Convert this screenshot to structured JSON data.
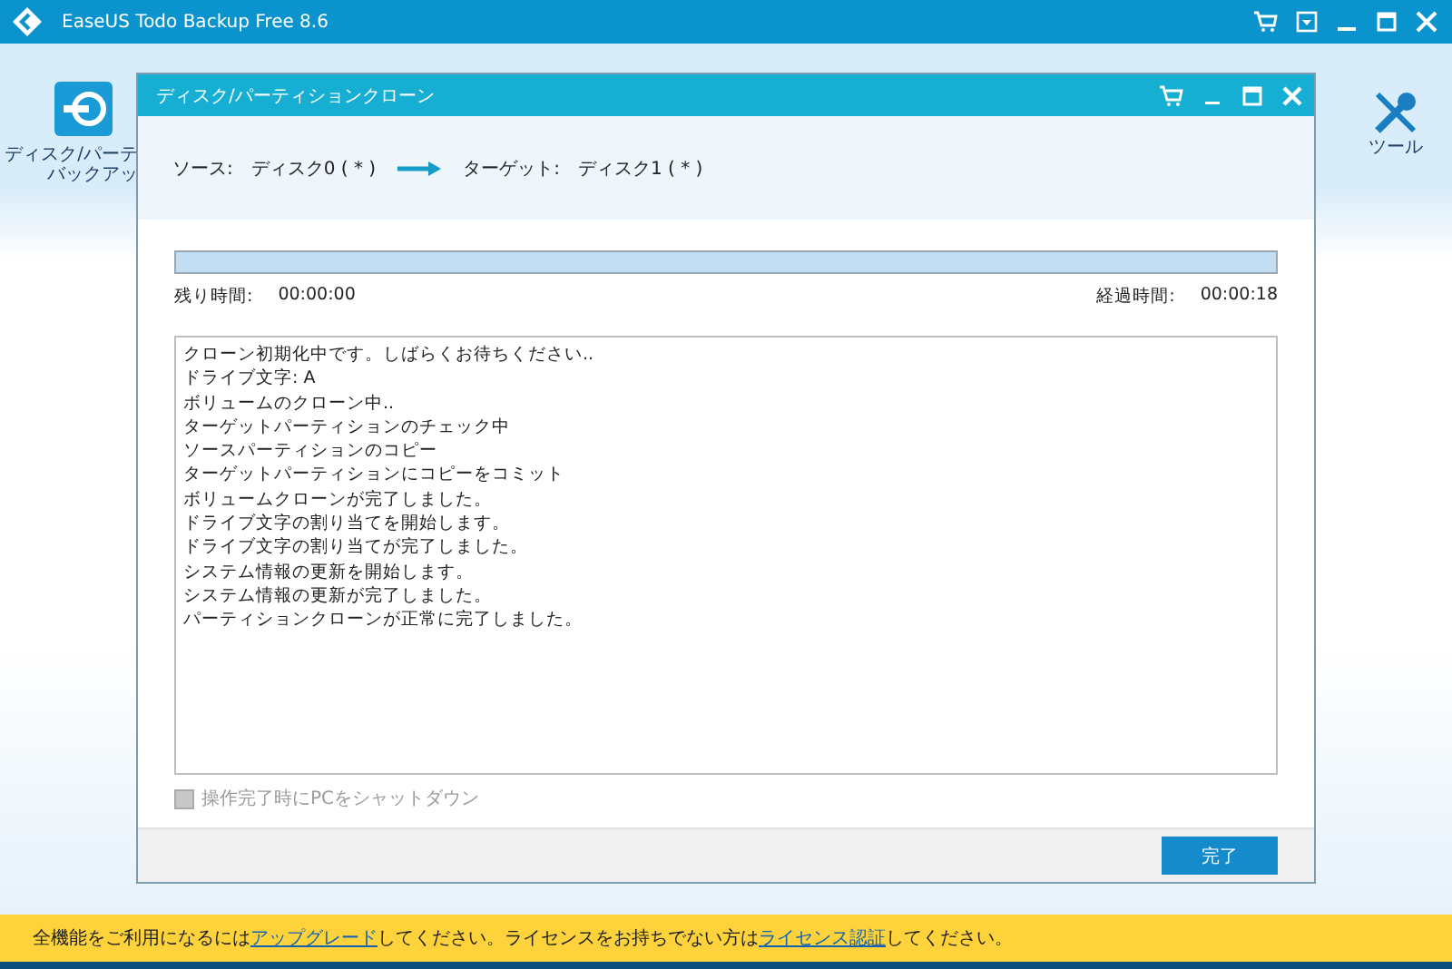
{
  "window": {
    "title": "EaseUS Todo Backup Free 8.6"
  },
  "toolbar": {
    "left_item": {
      "label_lines": [
        "ディスク/パーテ",
        "バックアッ"
      ]
    },
    "right_item": {
      "label": "ツール"
    }
  },
  "dialog": {
    "title": "ディスク/パーティションクローン",
    "source_label": "ソース:",
    "source_value": "ディスク0 ( * )",
    "target_label": "ターゲット:",
    "target_value": "ディスク1 ( * )",
    "progress": {
      "level": 1
    },
    "remaining_label": "残り時間:",
    "remaining_value": "00:00:00",
    "elapsed_label": "経過時間:",
    "elapsed_value": "00:00:18",
    "log": [
      "クローン初期化中です。しばらくお待ちください..",
      "ドライブ文字: A",
      "ボリュームのクローン中..",
      "ターゲットパーティションのチェック中",
      "ソースパーティションのコピー",
      "ターゲットパーティションにコピーをコミット",
      "ボリュームクローンが完了しました。",
      "ドライブ文字の割り当てを開始します。",
      "ドライブ文字の割り当てが完了しました。",
      "システム情報の更新を開始します。",
      "システム情報の更新が完了しました。",
      "パーティションクローンが正常に完了しました。"
    ],
    "shutdown_option": {
      "label": "操作完了時にPCをシャットダウン",
      "checked": false,
      "disabled": true
    },
    "button": "完了"
  },
  "banner": [
    {
      "kind": "text",
      "text": "全機能をご利用になるには"
    },
    {
      "kind": "link",
      "text": "アップグレード"
    },
    {
      "kind": "text",
      "text": "してください。ライセンスをお持ちでない方は"
    },
    {
      "kind": "link",
      "text": "ライセンス認証"
    },
    {
      "kind": "text",
      "text": "してください。"
    }
  ]
}
